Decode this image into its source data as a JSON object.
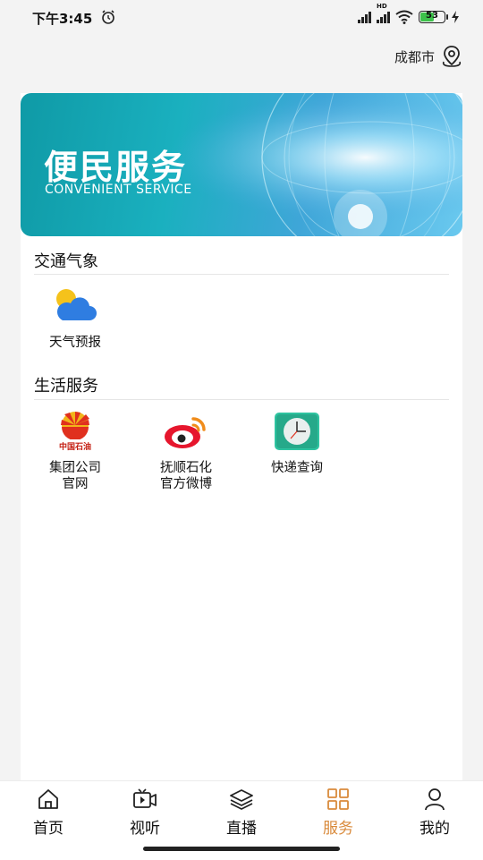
{
  "status_bar": {
    "time": "下午3:45",
    "hd_label": "HD",
    "battery": "53"
  },
  "location": {
    "city": "成都市"
  },
  "banner": {
    "title": "便民服务",
    "subtitle": "CONVENIENT SERVICE"
  },
  "sections": [
    {
      "title": "交通气象",
      "items": [
        {
          "label": "天气预报",
          "icon": "weather-icon"
        }
      ]
    },
    {
      "title": "生活服务",
      "items": [
        {
          "label": "集团公司\n官网",
          "icon": "petrochina-logo-icon",
          "logo_text": "中国石油"
        },
        {
          "label": "抚顺石化\n官方微博",
          "icon": "weibo-icon"
        },
        {
          "label": "快递查询",
          "icon": "clock-icon"
        }
      ]
    }
  ],
  "bottom_nav": {
    "items": [
      {
        "label": "首页",
        "icon": "home-icon"
      },
      {
        "label": "视听",
        "icon": "video-icon"
      },
      {
        "label": "直播",
        "icon": "layers-icon"
      },
      {
        "label": "服务",
        "icon": "grid-icon",
        "active": true
      },
      {
        "label": "我的",
        "icon": "user-icon"
      }
    ]
  },
  "colors": {
    "accent": "#d98a3b",
    "banner_start": "#0f9aa6",
    "banner_end": "#6ac9ef"
  }
}
